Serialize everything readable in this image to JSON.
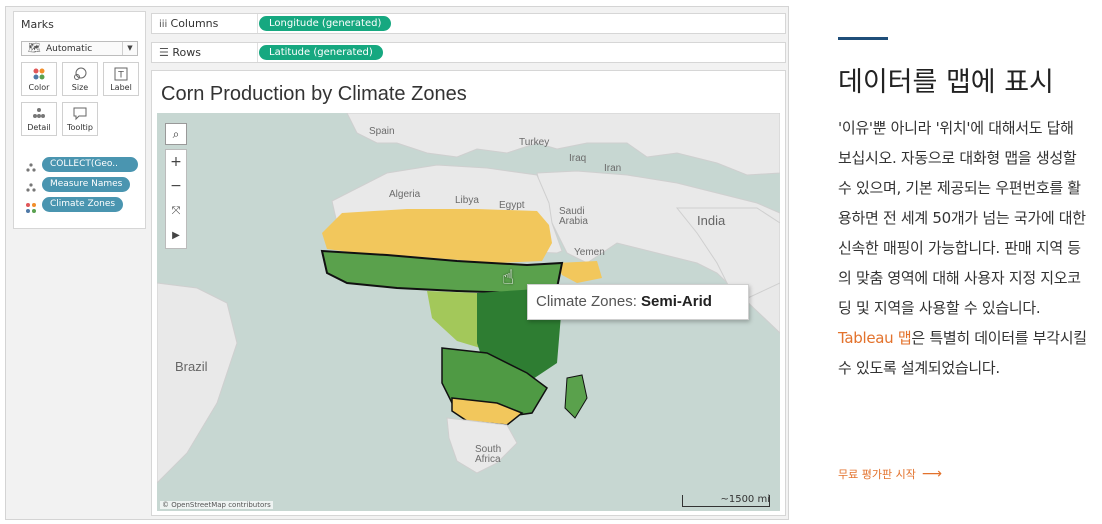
{
  "tableau": {
    "marks": {
      "title": "Marks",
      "mark_type": "Automatic",
      "buttons": [
        {
          "label": "Color",
          "icon": "color-dots-icon"
        },
        {
          "label": "Size",
          "icon": "size-icon"
        },
        {
          "label": "Label",
          "icon": "label-icon"
        },
        {
          "label": "Detail",
          "icon": "detail-icon"
        },
        {
          "label": "Tooltip",
          "icon": "tooltip-icon"
        }
      ],
      "pills": [
        "COLLECT(Geo..",
        "Measure Names",
        "Climate Zones"
      ]
    },
    "shelves": {
      "columns_label": "Columns",
      "columns_pill": "Longitude (generated)",
      "rows_label": "Rows",
      "rows_pill": "Latitude (generated)"
    },
    "viz": {
      "title": "Corn Production by Climate Zones",
      "tooltip_key": "Climate Zones:",
      "tooltip_value": "Semi-Arid",
      "map_labels": [
        "Spain",
        "Turkey",
        "Iraq",
        "Iran",
        "Algeria",
        "Libya",
        "Egypt",
        "Saudi Arabia",
        "India",
        "Yemen",
        "Brazil",
        "South Africa"
      ],
      "attribution": "© OpenStreetMap contributors",
      "scale": "~1500 mi",
      "colors": {
        "semi_arid": "#f2c75c",
        "tropical": "#5aa14c",
        "dark_green": "#2e7d32",
        "light_green": "#a3c85a",
        "water": "#c7d7d2",
        "land": "#e9e9e9"
      }
    }
  },
  "right": {
    "heading": "데이터를 맵에 표시",
    "body_before": "'이유'뿐 아니라 '위치'에 대해서도 답해 보십시오. 자동으로 대화형 맵을 생성할 수 있으며, 기본 제공되는 우편번호를 활용하면 전 세계 50개가 넘는 국가에 대한 신속한 매핑이 가능합니다. 판매 지역 등의 맞춤 영역에 대해 사용자 지정 지오코딩 및 지역을 사용할 수 있습니다. ",
    "link": "Tableau 맵",
    "body_after": "은 특별히 데이터를 부각시킬 수 있도록 설계되었습니다.",
    "cta": "무료 평가판 시작",
    "cta_arrow": "⟶"
  }
}
